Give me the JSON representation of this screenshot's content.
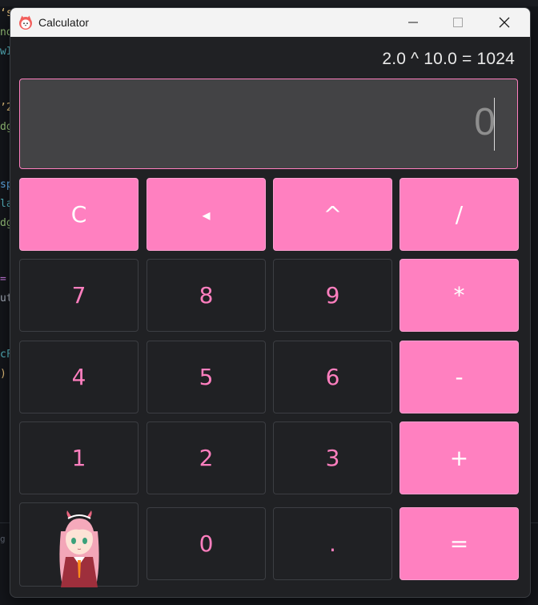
{
  "window": {
    "title": "Calculator"
  },
  "history": "2.0 ^ 10.0 = 1024",
  "display": {
    "value": "0"
  },
  "colors": {
    "accent": "#ff80c0",
    "surface": "#202124",
    "display_bg": "#434345"
  },
  "background_editor_lines": [
    {
      "text": "‘s",
      "color": "#e5c07b"
    },
    {
      "text": "nd",
      "color": "#98c379"
    },
    {
      "text": "wI",
      "color": "#56b6c2"
    },
    {
      "text": "’2",
      "color": "#e5c07b"
    },
    {
      "text": "dg",
      "color": "#98c379"
    },
    {
      "text": "sp",
      "color": "#61afef"
    },
    {
      "text": "la",
      "color": "#56b6c2"
    },
    {
      "text": "dg",
      "color": "#98c379"
    },
    {
      "text": "=",
      "color": "#c678dd"
    },
    {
      "text": "ut",
      "color": "#abb2bf"
    },
    {
      "text": "cF",
      "color": "#56b6c2"
    },
    {
      "text": ")",
      "color": "#e5c07b"
    },
    {
      "text": "g c",
      "color": "#5c6370"
    }
  ],
  "keypad": {
    "row1": [
      "C",
      "◂",
      "^",
      "/"
    ],
    "row2": [
      "7",
      "8",
      "9",
      "*"
    ],
    "row3": [
      "4",
      "5",
      "6",
      "-"
    ],
    "row4": [
      "1",
      "2",
      "3",
      "+"
    ],
    "row5": [
      "0",
      ".",
      "="
    ]
  }
}
